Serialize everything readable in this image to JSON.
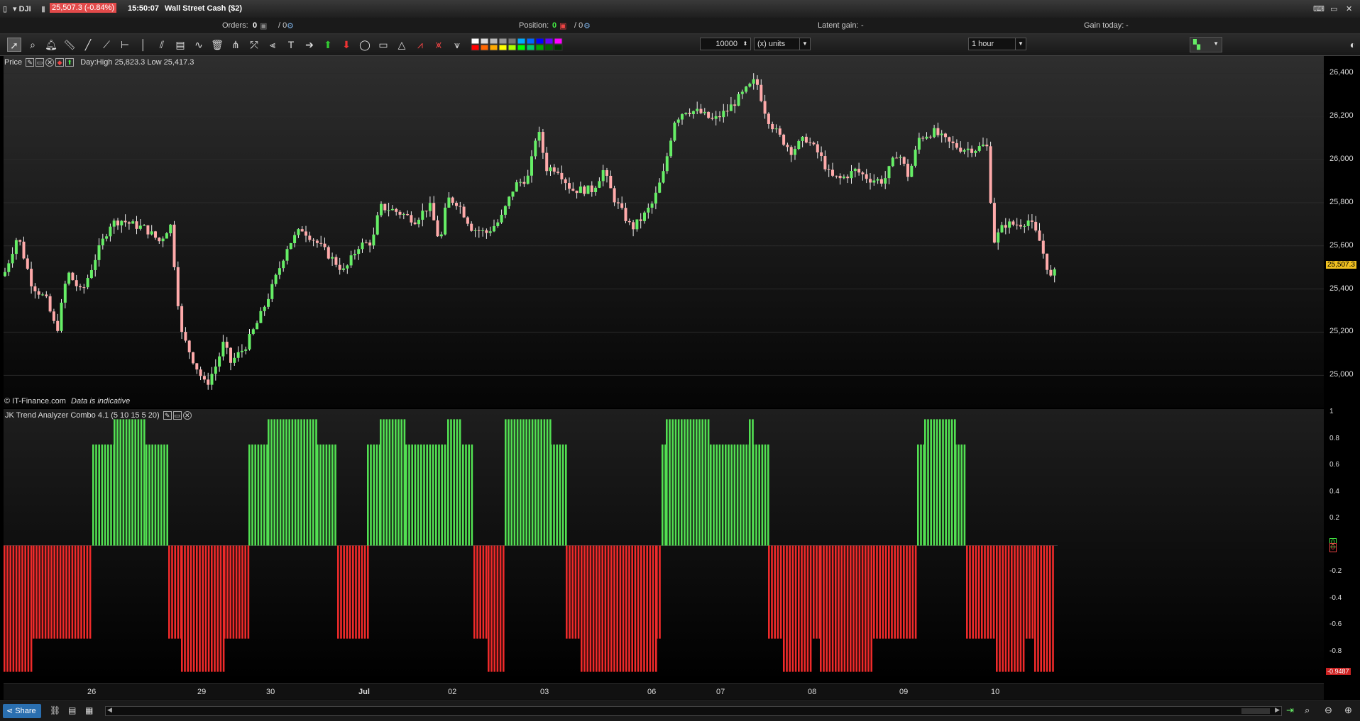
{
  "titlebar": {
    "symbol": "DJI",
    "price_change": "25,507.3 (-0.84%)",
    "time": "15:50:07",
    "instrument": "Wall Street Cash ($2)"
  },
  "infobar": {
    "orders_label": "Orders:",
    "orders_a": "0",
    "orders_b": "/ 0",
    "position_label": "Position:",
    "position_a": "0",
    "position_b": "/ 0",
    "latent_label": "Latent gain:",
    "latent_value": "-",
    "gain_today_label": "Gain today:",
    "gain_today_value": "-"
  },
  "toolbar": {
    "quantity": "10000",
    "units": "(x) units",
    "timeframe": "1 hour"
  },
  "price_panel": {
    "label": "Price",
    "day_info": "Day:High 25,823.3 Low 25,417.3",
    "copyright": "© IT-Finance.com",
    "disclaimer": "Data is indicative",
    "current_price": "25,507.3"
  },
  "indicator_panel": {
    "label": "JK Trend Analyzer Combo 4.1 (5 10 15 5 20)",
    "current_value": "-0.9487"
  },
  "price_axis": [
    "26,400",
    "26,200",
    "26,000",
    "25,800",
    "25,600",
    "25,400",
    "25,200",
    "25,000"
  ],
  "indicator_axis": [
    "1",
    "0.8",
    "0.6",
    "0.4",
    "0.2",
    "0",
    "0",
    "-0.2",
    "-0.4",
    "-0.6",
    "-0.8"
  ],
  "x_axis": [
    "26",
    "29",
    "30",
    "Jul",
    "02",
    "03",
    "06",
    "07",
    "08",
    "09",
    "10"
  ],
  "statusbar": {
    "share_label": "Share"
  },
  "colors": {
    "up": "#52e052",
    "down": "#ee2a2a",
    "bull_candle": "#66ee66",
    "bear_candle": "#ffaaaa",
    "price_tag": "#f0c020"
  },
  "chart_data": {
    "type": "candlestick",
    "timeframe": "1 hour",
    "ylim": [
      24850,
      26480
    ],
    "price_path": [
      [
        0,
        25460
      ],
      [
        20,
        25650
      ],
      [
        40,
        25420
      ],
      [
        60,
        25350
      ],
      [
        75,
        25200
      ],
      [
        90,
        25480
      ],
      [
        110,
        25380
      ],
      [
        130,
        25550
      ],
      [
        150,
        25700
      ],
      [
        165,
        25720
      ],
      [
        180,
        25700
      ],
      [
        200,
        25680
      ],
      [
        220,
        25620
      ],
      [
        235,
        25700
      ],
      [
        250,
        25200
      ],
      [
        270,
        25050
      ],
      [
        285,
        24950
      ],
      [
        300,
        25050
      ],
      [
        310,
        25150
      ],
      [
        320,
        25060
      ],
      [
        340,
        25130
      ],
      [
        360,
        25260
      ],
      [
        380,
        25420
      ],
      [
        400,
        25600
      ],
      [
        420,
        25680
      ],
      [
        440,
        25620
      ],
      [
        460,
        25550
      ],
      [
        480,
        25480
      ],
      [
        500,
        25600
      ],
      [
        520,
        25620
      ],
      [
        530,
        25780
      ],
      [
        545,
        25770
      ],
      [
        560,
        25750
      ],
      [
        580,
        25720
      ],
      [
        600,
        25790
      ],
      [
        615,
        25610
      ],
      [
        625,
        25820
      ],
      [
        640,
        25800
      ],
      [
        660,
        25680
      ],
      [
        680,
        25660
      ],
      [
        700,
        25720
      ],
      [
        720,
        25880
      ],
      [
        740,
        25920
      ],
      [
        752,
        26150
      ],
      [
        765,
        25960
      ],
      [
        780,
        25960
      ],
      [
        800,
        25860
      ],
      [
        830,
        25860
      ],
      [
        845,
        25950
      ],
      [
        860,
        25820
      ],
      [
        885,
        25680
      ],
      [
        900,
        25730
      ],
      [
        915,
        25800
      ],
      [
        930,
        25940
      ],
      [
        945,
        26180
      ],
      [
        960,
        26230
      ],
      [
        980,
        26220
      ],
      [
        1000,
        26180
      ],
      [
        1020,
        26230
      ],
      [
        1040,
        26300
      ],
      [
        1060,
        26370
      ],
      [
        1075,
        26200
      ],
      [
        1090,
        26120
      ],
      [
        1110,
        26040
      ],
      [
        1130,
        26100
      ],
      [
        1150,
        26020
      ],
      [
        1165,
        25920
      ],
      [
        1180,
        25910
      ],
      [
        1200,
        25950
      ],
      [
        1220,
        25910
      ],
      [
        1240,
        25900
      ],
      [
        1260,
        26040
      ],
      [
        1275,
        25920
      ],
      [
        1290,
        26100
      ],
      [
        1310,
        26130
      ],
      [
        1330,
        26080
      ],
      [
        1350,
        26050
      ],
      [
        1370,
        26050
      ],
      [
        1385,
        26070
      ],
      [
        1395,
        25620
      ],
      [
        1410,
        25700
      ],
      [
        1430,
        25700
      ],
      [
        1445,
        25720
      ],
      [
        1460,
        25620
      ],
      [
        1475,
        25450
      ],
      [
        1485,
        25490
      ]
    ],
    "trend_segments": [
      {
        "from": 0,
        "to": 41,
        "value": -0.95
      },
      {
        "from": 41,
        "to": 125,
        "value": -0.7
      },
      {
        "from": 125,
        "to": 155,
        "value": 0.76
      },
      {
        "from": 155,
        "to": 200,
        "value": 0.95
      },
      {
        "from": 200,
        "to": 232,
        "value": 0.76
      },
      {
        "from": 232,
        "to": 250,
        "value": -0.7
      },
      {
        "from": 250,
        "to": 310,
        "value": -0.95
      },
      {
        "from": 310,
        "to": 345,
        "value": -0.7
      },
      {
        "from": 345,
        "to": 372,
        "value": 0.76
      },
      {
        "from": 372,
        "to": 441,
        "value": 0.95
      },
      {
        "from": 441,
        "to": 470,
        "value": 0.76
      },
      {
        "from": 470,
        "to": 512,
        "value": -0.7
      },
      {
        "from": 512,
        "to": 530,
        "value": 0.76
      },
      {
        "from": 530,
        "to": 566,
        "value": 0.95
      },
      {
        "from": 566,
        "to": 625,
        "value": 0.76
      },
      {
        "from": 625,
        "to": 646,
        "value": 0.95
      },
      {
        "from": 646,
        "to": 662,
        "value": 0.76
      },
      {
        "from": 662,
        "to": 682,
        "value": -0.7
      },
      {
        "from": 682,
        "to": 706,
        "value": -0.95
      },
      {
        "from": 706,
        "to": 770,
        "value": 0.95
      },
      {
        "from": 770,
        "to": 792,
        "value": 0.76
      },
      {
        "from": 792,
        "to": 813,
        "value": -0.7
      },
      {
        "from": 813,
        "to": 919,
        "value": -0.95
      },
      {
        "from": 919,
        "to": 927,
        "value": -0.7
      },
      {
        "from": 927,
        "to": 933,
        "value": 0.76
      },
      {
        "from": 933,
        "to": 995,
        "value": 0.95
      },
      {
        "from": 995,
        "to": 1050,
        "value": 0.76
      },
      {
        "from": 1050,
        "to": 1055,
        "value": 0.95
      },
      {
        "from": 1055,
        "to": 1077,
        "value": 0.76
      },
      {
        "from": 1077,
        "to": 1098,
        "value": -0.7
      },
      {
        "from": 1098,
        "to": 1140,
        "value": -0.95
      },
      {
        "from": 1140,
        "to": 1150,
        "value": -0.7
      },
      {
        "from": 1150,
        "to": 1225,
        "value": -0.95
      },
      {
        "from": 1225,
        "to": 1287,
        "value": -0.7
      },
      {
        "from": 1287,
        "to": 1297,
        "value": 0.76
      },
      {
        "from": 1297,
        "to": 1340,
        "value": 0.95
      },
      {
        "from": 1340,
        "to": 1356,
        "value": 0.76
      },
      {
        "from": 1356,
        "to": 1398,
        "value": -0.7
      },
      {
        "from": 1398,
        "to": 1440,
        "value": -0.95
      },
      {
        "from": 1440,
        "to": 1452,
        "value": -0.7
      },
      {
        "from": 1452,
        "to": 1480,
        "value": -0.95
      }
    ],
    "indicator_ylim": [
      -1.0,
      1.0
    ]
  }
}
